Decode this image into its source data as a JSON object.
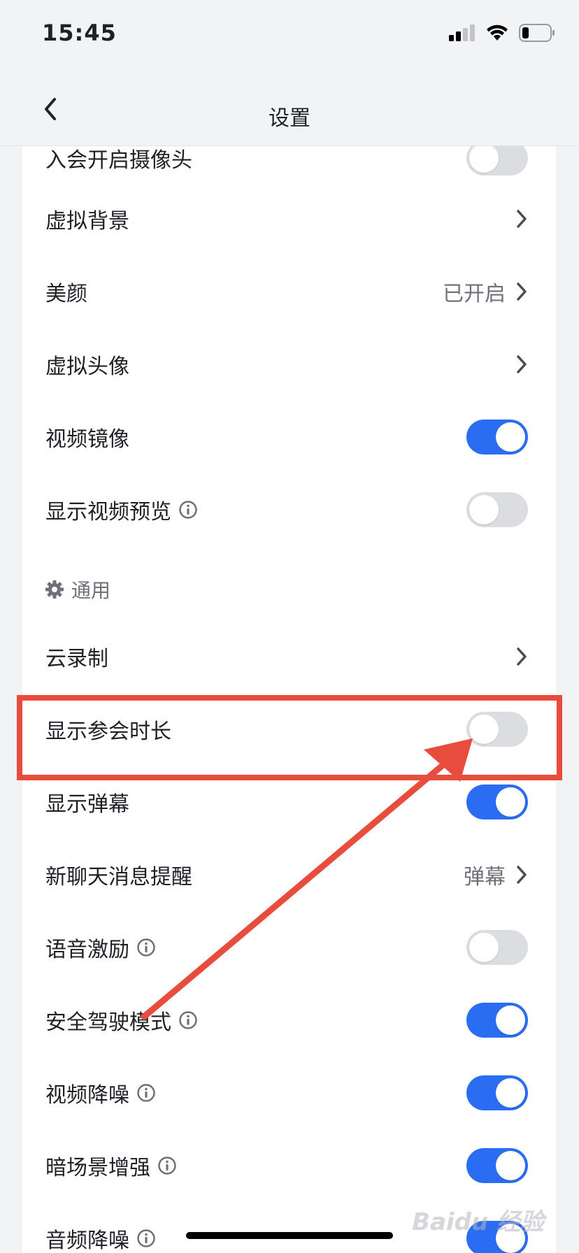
{
  "status_bar": {
    "time": "15:45"
  },
  "nav": {
    "title": "设置"
  },
  "card1": {
    "partial_label": "入会开启摄像头",
    "items": [
      {
        "label": "虚拟背景"
      },
      {
        "label": "美颜",
        "value": "已开启"
      },
      {
        "label": "虚拟头像"
      },
      {
        "label": "视频镜像",
        "toggle": true
      },
      {
        "label": "显示视频预览",
        "toggle": false
      }
    ]
  },
  "card2": {
    "section_title": "通用",
    "items": [
      {
        "label": "云录制"
      },
      {
        "label": "显示参会时长",
        "toggle": false
      },
      {
        "label": "显示弹幕",
        "toggle": true
      },
      {
        "label": "新聊天消息提醒",
        "value": "弹幕"
      },
      {
        "label": "语音激励",
        "toggle": false
      },
      {
        "label": "安全驾驶模式",
        "toggle": true
      },
      {
        "label": "视频降噪",
        "toggle": true
      },
      {
        "label": "暗场景增强",
        "toggle": true
      },
      {
        "label": "音频降噪",
        "toggle": true
      }
    ]
  },
  "colors": {
    "accent": "#2b6df2",
    "annotation": "#e84c3d",
    "toggle_off": "#dcdde0"
  },
  "watermark": "Baidu 经验"
}
